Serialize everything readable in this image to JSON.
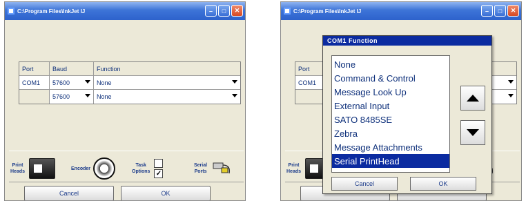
{
  "window": {
    "title": "C:\\Program Files\\InkJet   IJ",
    "controls": {
      "min": "–",
      "max": "□",
      "close": "✕"
    }
  },
  "grid": {
    "headers": [
      "Port",
      "Baud",
      "Function"
    ],
    "rows": [
      {
        "port": "COM1",
        "baud": "57600",
        "function": "None"
      },
      {
        "port": "",
        "baud": "57600",
        "function": "None"
      }
    ]
  },
  "toolbar": {
    "print_heads": "Print\nHeads",
    "encoder": "Encoder",
    "task_options": "Task\nOptions",
    "serial_ports": "Serial\nPorts",
    "checkbox2_state": "✓"
  },
  "buttons": {
    "cancel": "Cancel",
    "ok": "OK"
  },
  "popup": {
    "title": "COM1 Function",
    "options": [
      "None",
      "Command & Control",
      "Message Look Up",
      "External Input",
      "SATO 8485SE",
      "Zebra",
      "Message Attachments",
      "Serial PrintHead"
    ],
    "selected_index": 7,
    "cancel": "Cancel",
    "ok": "OK"
  }
}
